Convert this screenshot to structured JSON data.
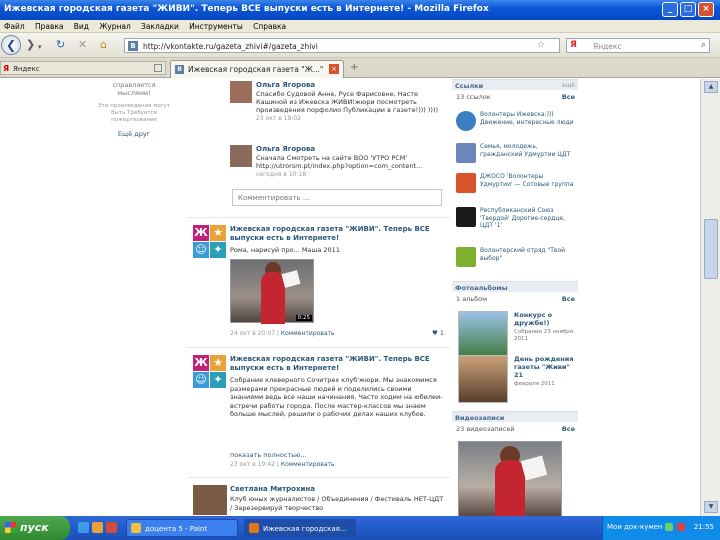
{
  "window": {
    "title": "Ижевская городская газета \"ЖИВИ\". Теперь ВСЕ выпуски есть в Интернете! - Mozilla Firefox"
  },
  "menu": [
    "Файл",
    "Правка",
    "Вид",
    "Журнал",
    "Закладки",
    "Инструменты",
    "Справка"
  ],
  "nav": {
    "url": "http://vkontakte.ru/gazeta_zhivi#/gazeta_zhivi",
    "search_placeholder": "Яндекс",
    "search_engine_glyph": "Я"
  },
  "bookmarks": {
    "label": "Яндекс"
  },
  "tab": {
    "label": "Ижевская городская газета \"Ж...\"",
    "favicon": "B"
  },
  "left_col": {
    "line1": "справляется",
    "line2": "мыслями!",
    "small": "Эти произведения могут быть Требуется пожертвование",
    "link": "Ещё друг"
  },
  "comments": [
    {
      "name": "Ольга Ягорова",
      "text": "Спасибо Судовой Анне, Русе Фарисовне, Насте Кашиной из Ижевска ЖИВИ!жюри посмотреть произведения порфолио Публикации в газете!))) ))))",
      "time": "23 окт в 19:02"
    },
    {
      "name": "Ольга Ягорова",
      "text": "Сначала Смотреть на сайте ВОО 'УТРО РСМ' http://utrorsm.pt/index.php?option=com_content...",
      "time": "сегодня в 10:18"
    }
  ],
  "comment_placeholder": "Комментировать ...",
  "posts": [
    {
      "title": "Ижевская городская газета \"ЖИВИ\". Теперь ВСЕ выпуски есть в Интернете!",
      "body": "Рома, нарисуй про... Маша 2011",
      "meta_time": "24 окт в 20:07",
      "meta_link": "Комментировать",
      "likes": "1",
      "video_duration": "0:25"
    },
    {
      "title": "Ижевская городская газета \"ЖИВИ\". Теперь ВСЕ выпуски есть в Интернете!",
      "body": "Собрание клеверного Сочитрех клуб'жюри. Мы знакомимся размерами прекрасные людей и поделились своими знаниями ведь все наши начинания. Часто ходим на юбилеи-встречи работы города. После мастер-классов мы знаем больше мыслей, решили о рабочих делах наших клубов.",
      "more": "показать полностью...",
      "meta_time": "23 окт в 19:42",
      "meta_link": "Комментировать"
    }
  ],
  "bottom_author": {
    "name": "Светлана Митрохина",
    "text": "Клуб юных журналистов / Объединения / Фестиваль НЕТ-ЦДТ / Зарезервируй творчество"
  },
  "right_col": {
    "links_head": "Ссылки",
    "links_head_right": "ещё",
    "links_count": "13 ссылок",
    "links_all": "Все",
    "groups": [
      {
        "name": "Волонтеры Ижевска:))) Движение, интересные люди",
        "color": "#3a7ec4"
      },
      {
        "name": "Семья, молодежь, гражданский Удмуртии ЦДТ",
        "color": "#6b86b8"
      },
      {
        "name": "ДЖОСО 'Волонтеры Удмуртии' — Сотовые группа",
        "color": "#d9532a"
      },
      {
        "name": "Республиканский Союз 'Твердой' Дорогие-сердце, ЦДТ '1'",
        "color": "#1a1a1a"
      },
      {
        "name": "Волонтерский отряд \"Твой выбор\"",
        "color": "#7fb02e"
      }
    ],
    "events_head": "Фотоальбомы",
    "events_sub": "1 альбом",
    "events_all": "Все",
    "events": [
      {
        "name": "Конкурс о дружбе!)",
        "date": "Собрание 23 ноября. 2011"
      },
      {
        "name": "День рождения газеты \"Живи\" 21",
        "date": "февраля 2011"
      }
    ],
    "video_head": "Видеозаписи",
    "video_sub": "23 видеозаписей",
    "video_all": "Все"
  },
  "taskbar": {
    "start": "пуск",
    "buttons": [
      "доцента 5 - Paint",
      "Ижевская городская..."
    ],
    "tray_text": "Мои док-кумен",
    "clock": "21:55"
  }
}
